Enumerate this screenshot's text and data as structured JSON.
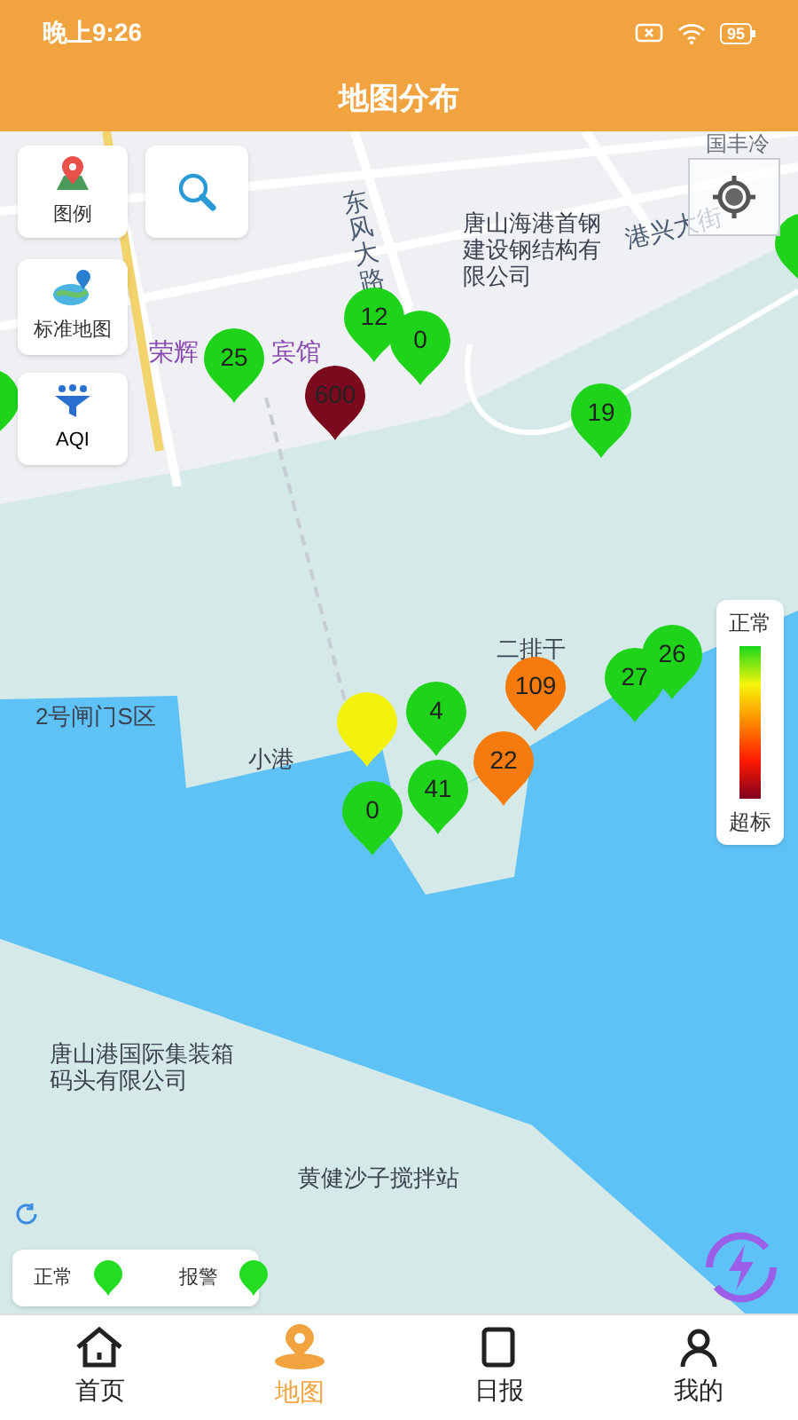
{
  "status_bar": {
    "time": "晚上9:26",
    "battery": "95"
  },
  "title": "地图分布",
  "tools": [
    {
      "kind": "legend",
      "label": "图例"
    },
    {
      "kind": "search"
    },
    {
      "kind": "map_type",
      "label": "标准地图"
    },
    {
      "kind": "aqi",
      "label": "AQI"
    }
  ],
  "map_labels": [
    {
      "kind": "vertical",
      "text": "东风大路"
    },
    {
      "kind": "road",
      "text": "国丰冷"
    },
    {
      "kind": "place",
      "text": "唐山海港首钢建设钢结构有限公司"
    },
    {
      "kind": "tilted",
      "text": "港兴大街"
    },
    {
      "kind": "poi",
      "text": "荣辉"
    },
    {
      "kind": "poi",
      "text": "宾馆"
    },
    {
      "kind": "place",
      "text": "二排干"
    },
    {
      "kind": "place",
      "text": "2号闸门S区"
    },
    {
      "kind": "place",
      "text": "小港"
    },
    {
      "kind": "place",
      "text": "唐山港国际集装箱码头有限公司"
    },
    {
      "kind": "place",
      "text": "黄健沙子搅拌站"
    }
  ],
  "markers": [
    {
      "value": "12",
      "color": "#1fd31b"
    },
    {
      "value": "0",
      "color": "#1fd31b"
    },
    {
      "value": "25",
      "color": "#1fd31b"
    },
    {
      "value": "600",
      "color": "#7b0a1e"
    },
    {
      "value": "19",
      "color": "#1fd31b"
    },
    {
      "color": "#1fd31b"
    },
    {
      "color": "#1fd31b"
    },
    {
      "value": "109",
      "color": "#f77b0c"
    },
    {
      "value": "27",
      "color": "#1fd31b"
    },
    {
      "value": "26",
      "color": "#1fd31b"
    },
    {
      "value": "4",
      "color": "#1fd31b"
    },
    {
      "color": "#f2f20c"
    },
    {
      "value": "22",
      "color": "#f77b0c"
    },
    {
      "value": "41",
      "color": "#1fd31b"
    },
    {
      "value": "0",
      "color": "#1fd31b"
    }
  ],
  "scale": {
    "top": "正常",
    "bottom": "超标"
  },
  "legend": [
    {
      "label": "正常",
      "color": "#22dd22"
    },
    {
      "label": "报警",
      "color": "#22dd22"
    }
  ],
  "tabs": [
    {
      "label": "首页",
      "selected": false
    },
    {
      "label": "地图",
      "selected": true
    },
    {
      "label": "日报",
      "selected": false
    },
    {
      "label": "我的",
      "selected": false
    }
  ]
}
